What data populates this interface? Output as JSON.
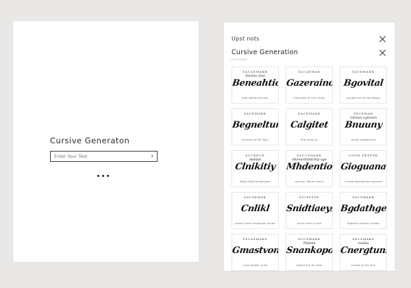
{
  "left_panel": {
    "title": "Cursive Generaton",
    "input_placeholder": "Enter Your Text",
    "submit_arrow": "›"
  },
  "right_panel": {
    "top_label": "Upst nots",
    "title": "Cursive Generation",
    "subtitle": "JSECDBD",
    "close_icons": [
      "close-icon",
      "close-icon"
    ]
  },
  "tiles": [
    {
      "top": "ΣΑCΑΕΜΑΚΒ",
      "small": "Tolctes Sne",
      "main": "Beneahtion",
      "cap": "oset tofitecrea nen"
    },
    {
      "top": "ΣΑCΑΕΜΑΚ",
      "small": "",
      "main": "Gazeraino",
      "cap": "Okonoest of lore vtvas"
    },
    {
      "top": "ΣΑCΕΜΑΚΚ",
      "small": "",
      "main": "Bgovital",
      "cap": "Auueat fen at tse ewtay"
    },
    {
      "top": "ΣΑCΕΜΑΚΚ",
      "small": "",
      "main": "Begneltun",
      "cap": "Gunrest of for Tesy"
    },
    {
      "top": "ΣΑCΕΜΑΚΚ",
      "small": "",
      "main": "Calgitet",
      "cap": "Rlus endy ar"
    },
    {
      "top": "ΣΕCΕΜΑΚ",
      "small": "rotioas uytooen",
      "main": "Bnuuny",
      "cap": "ancot etiogennna"
    },
    {
      "top": "ΣCCΕΝCΕ",
      "small": "Aebtut",
      "main": "Clnikitiy",
      "cap": "Wsey Eboniluisonrese"
    },
    {
      "top": "ΣACCΣΜΑΚΚ",
      "small": "nhenertllsttrmp vge",
      "main": "Mhdention",
      "cap": "ranncor Menle reasn"
    },
    {
      "top": "COON ΣΕΣΣΣΚ",
      "small": "",
      "main": "Gioguana",
      "cap": "a efnet Benesfnea rovenne"
    },
    {
      "top": "ΣΑCΣΕΜΑΚ",
      "small": "",
      "main": "Cnlikl",
      "cap": "Leusis Enmt Shofasiat anvoe"
    },
    {
      "top": "ΣΙCΣΡΣΣΣ",
      "small": "",
      "main": "Snidtiaeys",
      "cap": "Sncrk tcltt a rook"
    },
    {
      "top": "ΣΑCΣΜΑΚΚ",
      "small": "",
      "main": "Bgdathgen",
      "cap": "Egaaine thoiaint anvee"
    },
    {
      "top": "ΣΣCΑΣΜΑΚΣ",
      "small": "",
      "main": "Gmastvon",
      "cap": "Lnae fovath curte"
    },
    {
      "top": "ΣCCΣΜΑΚΚ",
      "small": "Tsldete",
      "main": "Snankopolrs",
      "cap": "Upsed the fer feus"
    },
    {
      "top": "ΣΕCΣΜΑΚΣ",
      "small": "mubla",
      "main": "Cnergtuns",
      "cap": "hnnwd of let fera"
    }
  ]
}
